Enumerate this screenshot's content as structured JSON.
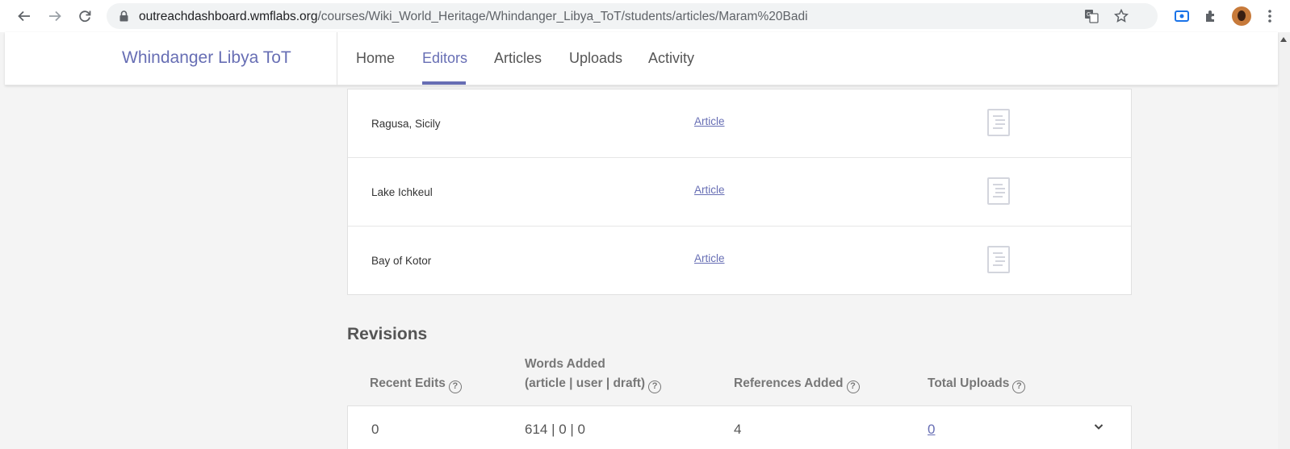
{
  "browser": {
    "url_host": "outreachdashboard.wmflabs.org",
    "url_path": "/courses/Wiki_World_Heritage/Whindanger_Libya_ToT/students/articles/Maram%20Badi",
    "icons": [
      "back-icon",
      "forward-icon",
      "reload-icon",
      "lock-icon",
      "translate-icon",
      "star-icon",
      "screencast-icon",
      "extensions-icon",
      "profile-avatar",
      "menu-icon"
    ]
  },
  "header": {
    "course_title": "Whindanger Libya ToT",
    "nav": [
      "Home",
      "Editors",
      "Articles",
      "Uploads",
      "Activity"
    ],
    "active_nav": "Editors"
  },
  "articles": [
    {
      "title": "Ragusa, Sicily",
      "link": "Article"
    },
    {
      "title": "Lake Ichkeul",
      "link": "Article"
    },
    {
      "title": "Bay of Kotor",
      "link": "Article"
    }
  ],
  "revisions": {
    "title": "Revisions",
    "headers": {
      "recent_edits": "Recent Edits",
      "words_added_line1": "Words Added",
      "words_added_line2": "(article | user | draft)",
      "references_added": "References Added",
      "total_uploads": "Total Uploads"
    },
    "help_glyph": "?",
    "row": {
      "recent_edits": "0",
      "words_added": "614 | 0 | 0",
      "references_added": "4",
      "total_uploads": "0"
    }
  },
  "colors": {
    "accent": "#676eb4",
    "page_bg": "#f4f4f4"
  }
}
